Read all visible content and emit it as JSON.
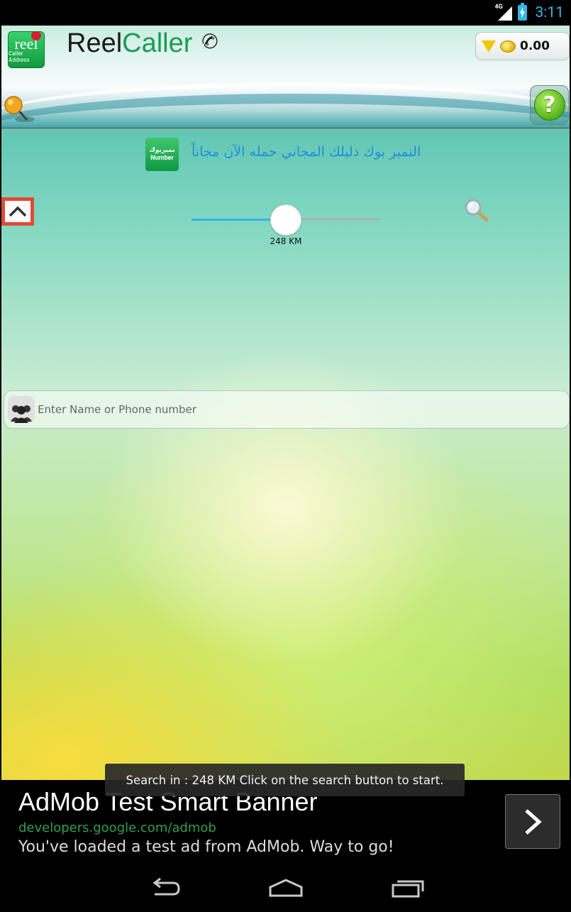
{
  "status_bar": {
    "network_label": "4G",
    "time": "3:11"
  },
  "header": {
    "logo_text": "reel",
    "logo_subtext": "Caller Address",
    "brand_reel": "Reel",
    "brand_caller": "Caller",
    "coin_value": "0.00"
  },
  "promo": {
    "icon_text_top": "نمبربوك",
    "icon_text_bottom": "Number",
    "text": "النمبر بوك دليلك المجاني حمله الآن مجاناً"
  },
  "slider": {
    "value_label": "248 KM",
    "fraction": 0.5
  },
  "search": {
    "placeholder": "Enter Name or Phone number"
  },
  "toast": {
    "text": "Search in : 248 KM Click on the search button to start."
  },
  "ad": {
    "title": "AdMob Test Smart Banner",
    "url": "developers.google.com/admob",
    "description": "You've loaded a test ad from AdMob. Way to go!"
  },
  "colors": {
    "accent": "#33b5e5",
    "brand_green": "#1a9c55",
    "promo_blue": "#1d8fe0",
    "collapse_red": "#e24a34"
  }
}
